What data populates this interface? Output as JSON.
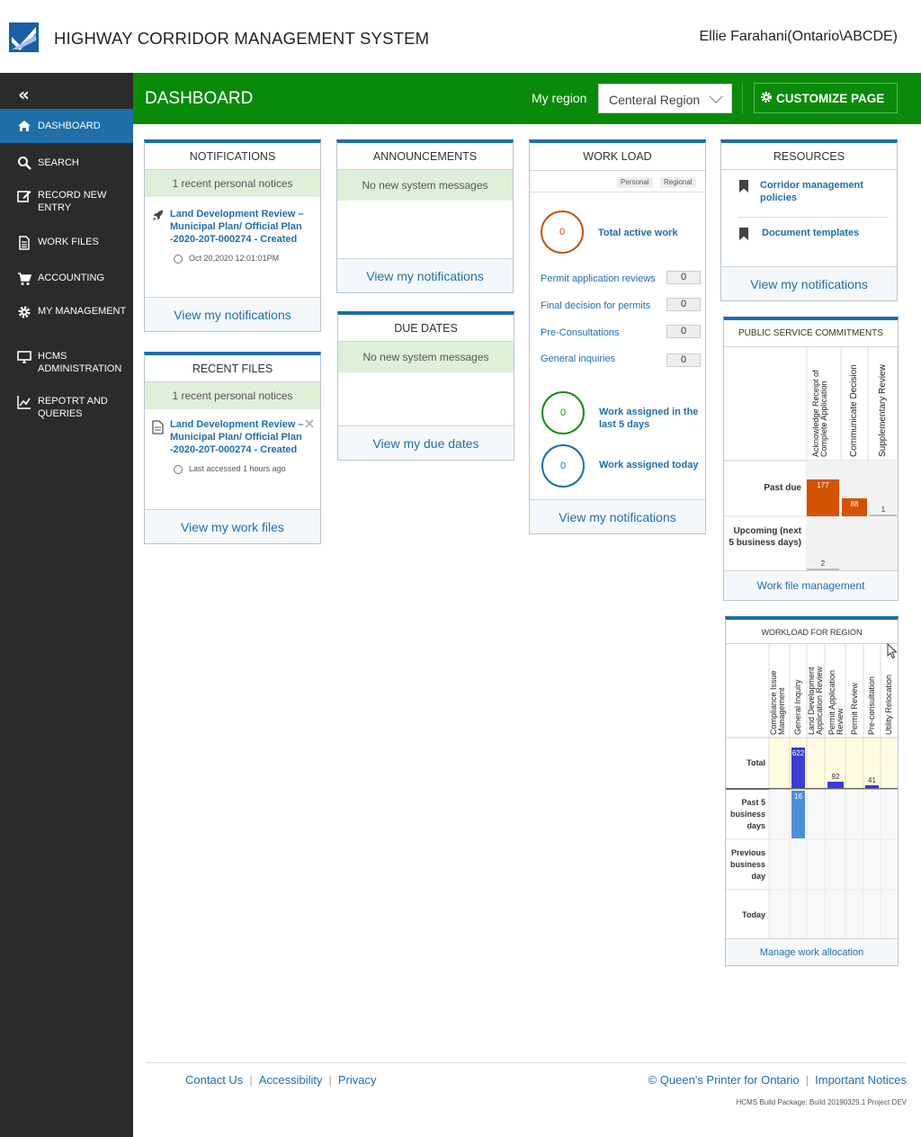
{
  "app": {
    "title": "HIGHWAY CORRIDOR MANAGEMENT SYSTEM",
    "user": "Ellie Farahani(Ontario\\ABCDE)",
    "brand_color": "#0a8a0a",
    "accent_color": "#1e6fa8"
  },
  "sidebar": {
    "collapse_icon": "double-chevron-left-icon",
    "items": [
      {
        "label": "DASHBOARD",
        "icon": "home-icon",
        "active": true
      },
      {
        "label": "SEARCH",
        "icon": "search-icon"
      },
      {
        "label": "RECORD NEW ENTRY",
        "icon": "edit-icon"
      },
      {
        "label": "WORK FILES",
        "icon": "document-icon"
      },
      {
        "label": "ACCOUNTING",
        "icon": "cart-icon"
      },
      {
        "label": "MY MANAGEMENT",
        "icon": "gear-icon"
      },
      {
        "label": "HCMS ADMINISTRATION",
        "icon": "monitor-icon"
      },
      {
        "label": "REPOTRT AND QUERIES",
        "icon": "chart-icon"
      }
    ]
  },
  "header": {
    "title": "DASHBOARD",
    "region_label": "My region",
    "region_value": "Centeral Region",
    "customize_label": "CUSTOMIZE PAGE"
  },
  "notifications": {
    "title": "NOTIFICATIONS",
    "banner": "1 recent personal notices",
    "item_text": "Land Development Review – Municipal Plan/ Official Plan -2020-20T-000274 - Created",
    "item_time": "Oct 20,2020 12:01:01PM",
    "footer": "View my notifications"
  },
  "recent_files": {
    "title": "RECENT FILES",
    "banner": "1 recent personal notices",
    "item_text": "Land Development Review – Municipal Plan/ Official Plan -2020-20T-000274 - Created",
    "item_time": "Last accessed 1 hours ago",
    "footer": "View my work files"
  },
  "announcements": {
    "title": "ANNOUNCEMENTS",
    "banner": "No new system messages",
    "footer": "View my notifications"
  },
  "due_dates": {
    "title": "DUE DATES",
    "banner": "No new system messages",
    "footer": "View my due dates"
  },
  "workload": {
    "title": "WORK LOAD",
    "toggle_personal": "Personal",
    "toggle_regional": "Regional",
    "total_active_value": "0",
    "total_active_label": "Total active work",
    "rows": [
      {
        "label": "Permit application reviews",
        "value": "0"
      },
      {
        "label": "Final decision for permits",
        "value": "0"
      },
      {
        "label": "Pre-Consultations",
        "value": "0"
      },
      {
        "label": "General inquiries",
        "value": "0"
      }
    ],
    "last5_value": "0",
    "last5_label": "Work assigned in the last 5 days",
    "today_value": "0",
    "today_label": "Work assigned today",
    "footer": "View my notifications"
  },
  "resources": {
    "title": "RESOURCES",
    "items": [
      "Corridor management policies",
      "Document templates"
    ],
    "footer": "View my notifications"
  },
  "psc": {
    "title": "PUBLIC SERVICE COMMITMENTS",
    "columns": [
      "Acknowledge Receipt of Complete Application",
      "Communicate Decision",
      "Supplementary Review"
    ],
    "rows": [
      "Past due",
      "Upcoming (next 5 business days)"
    ],
    "footer": "Work file management"
  },
  "wfr": {
    "title": "WORKLOAD FOR REGION",
    "columns": [
      "Compliance Issue Management",
      "General Inquiry",
      "Land Development Application Review",
      "Permit Application Review",
      "Permit Review",
      "Pre-consultation",
      "Utility Relocation"
    ],
    "rows": [
      "Total",
      "Past 5 business days",
      "Previous business day",
      "Today"
    ],
    "footer": "Manage work allocation"
  },
  "chart_data": [
    {
      "type": "bar",
      "title": "PUBLIC SERVICE COMMITMENTS",
      "categories": [
        "Acknowledge Receipt of Complete Application",
        "Communicate Decision",
        "Supplementary Review"
      ],
      "series": [
        {
          "name": "Past due",
          "values": [
            177,
            88,
            1
          ],
          "color": "#d35400"
        },
        {
          "name": "Upcoming (next 5 business days)",
          "values": [
            2,
            0,
            0
          ],
          "color": "#2e8b57"
        }
      ]
    },
    {
      "type": "bar",
      "title": "WORKLOAD FOR REGION",
      "categories": [
        "Compliance Issue Management",
        "General Inquiry",
        "Land Development Application Review",
        "Permit Application Review",
        "Permit Review",
        "Pre-consultation",
        "Utility Relocation"
      ],
      "series": [
        {
          "name": "Total",
          "values": [
            0,
            622,
            0,
            92,
            0,
            41,
            0
          ],
          "color": "#3b3bd6"
        },
        {
          "name": "Past 5 business days",
          "values": [
            0,
            16,
            0,
            0,
            0,
            0,
            0
          ],
          "color": "#4a90d9"
        },
        {
          "name": "Previous business day",
          "values": [
            0,
            0,
            0,
            0,
            0,
            0,
            0
          ]
        },
        {
          "name": "Today",
          "values": [
            0,
            0,
            0,
            0,
            0,
            0,
            0
          ]
        }
      ]
    }
  ],
  "footer": {
    "links": [
      "Contact Us",
      "Accessibility",
      "Privacy"
    ],
    "copyright": "© Queen's Printer for Ontario",
    "notices": "Important Notices",
    "build": "HCMS Build Package: Build 20190329.1 Project DEV"
  }
}
